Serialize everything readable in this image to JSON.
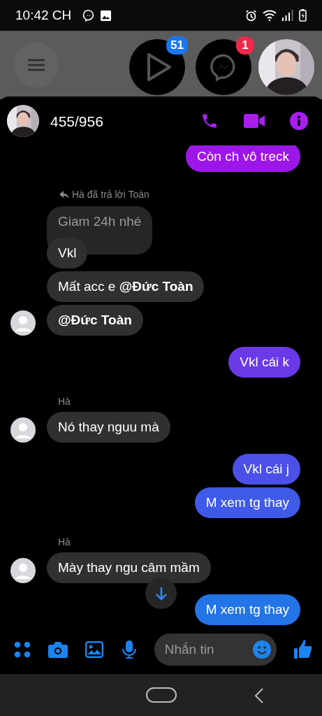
{
  "status_bar": {
    "time": "10:42 CH"
  },
  "chat_heads": [
    {
      "kind": "video",
      "badge": "51",
      "color": "#1877f2"
    },
    {
      "kind": "messenger",
      "badge": "1",
      "color": "#f02849"
    },
    {
      "kind": "avatar"
    }
  ],
  "conversation": {
    "title": "455/956"
  },
  "messages": [
    {
      "kind": "sent",
      "text": "Còn ch vô treck",
      "color": "#9d16e8"
    },
    {
      "kind": "reply_note",
      "text": "Hà đã trả lời Toàn"
    },
    {
      "kind": "quoted",
      "text": "Giam 24h nhé"
    },
    {
      "kind": "received",
      "text": "Vkl",
      "avatar": false
    },
    {
      "kind": "received",
      "text": "Mất acc e **@Đức Toàn**",
      "avatar": false
    },
    {
      "kind": "received",
      "text": "**@Đức Toàn**",
      "avatar": true
    },
    {
      "kind": "sent",
      "text": "Vkl cái k",
      "color": "#6a3ae8"
    },
    {
      "kind": "sender",
      "text": "Hà"
    },
    {
      "kind": "received",
      "text": "Nó thay nguu mà",
      "avatar": true
    },
    {
      "kind": "sent",
      "text": "Vkl cái j",
      "color": "#4a50e8"
    },
    {
      "kind": "sent",
      "text": "M xem tg thay",
      "color": "#3f5ae8"
    },
    {
      "kind": "sender",
      "text": "Hà"
    },
    {
      "kind": "received",
      "text": "Mày thay ngu câm mầm",
      "avatar": true
    },
    {
      "kind": "sent",
      "text": "M xem tg thay",
      "color": "#2374e6"
    }
  ],
  "composer": {
    "placeholder": "Nhắn tin"
  }
}
